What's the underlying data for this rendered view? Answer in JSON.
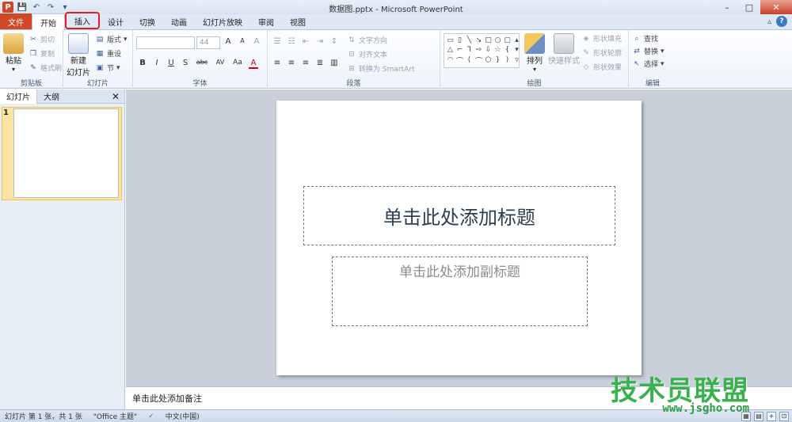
{
  "window": {
    "title": "数据图.pptx - Microsoft PowerPoint",
    "logo": "P",
    "controls": [
      "–",
      "□",
      "✕"
    ]
  },
  "qat": {
    "save": "💾",
    "undo": "↶",
    "redo": "↷",
    "more": "▾"
  },
  "tabs": [
    {
      "label": "文件"
    },
    {
      "label": "开始"
    },
    {
      "label": "插入"
    },
    {
      "label": "设计"
    },
    {
      "label": "切换"
    },
    {
      "label": "动画"
    },
    {
      "label": "幻灯片放映"
    },
    {
      "label": "审阅"
    },
    {
      "label": "视图"
    }
  ],
  "ribbon": {
    "clipboard": {
      "label": "剪贴板",
      "paste": "粘贴",
      "cut": "剪切",
      "copy": "复制",
      "format_painter": "格式刷"
    },
    "slides": {
      "label": "幻灯片",
      "new_slide_line1": "新建",
      "new_slide_line2": "幻灯片",
      "layout": "版式",
      "reset": "重设",
      "section": "节"
    },
    "font": {
      "label": "字体",
      "font_size": "44",
      "bold": "B",
      "italic": "I",
      "underline": "U",
      "shadow": "S",
      "strike": "abc",
      "spacing": "AV",
      "case": "Aa",
      "color": "A",
      "grow": "A",
      "shrink": "A",
      "clear": "A"
    },
    "paragraph": {
      "label": "段落",
      "text_direction": "文字方向",
      "align_text": "对齐文本",
      "smartart": "转换为 SmartArt"
    },
    "drawing": {
      "label": "绘图",
      "arrange": "排列",
      "quick_styles": "快速样式",
      "shape_fill": "形状填充",
      "shape_outline": "形状轮廓",
      "shape_effects": "形状效果"
    },
    "editing": {
      "label": "编辑",
      "find": "查找",
      "replace": "替换",
      "select": "选择"
    }
  },
  "left_panel": {
    "tabs": [
      "幻灯片",
      "大纲"
    ],
    "close": "✕",
    "thumb_number": "1"
  },
  "slide": {
    "title_placeholder": "单击此处添加标题",
    "subtitle_placeholder": "单击此处添加副标题"
  },
  "notes": {
    "placeholder": "单击此处添加备注"
  },
  "status": {
    "slide_info": "幻灯片 第 1 张，共 1 张",
    "theme": "\"Office 主题\"",
    "language": "中文(中国)"
  },
  "watermark": {
    "cn": "技术员联盟",
    "en": "www.jsgho.com"
  }
}
